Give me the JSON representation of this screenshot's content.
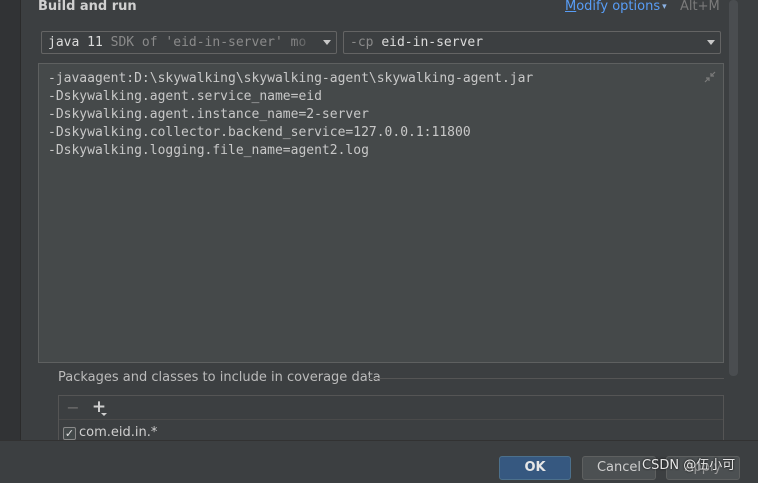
{
  "section": {
    "title": "Build and run",
    "modify_first": "M",
    "modify_rest": "odify options",
    "shortcut": "Alt+M"
  },
  "jre_combo": {
    "version": "java 11",
    "detail": "SDK of 'eid-in-server' mo"
  },
  "classpath_combo": {
    "flag": "-cp",
    "module": "eid-in-server"
  },
  "vm_options": {
    "lines": [
      "-javaagent:D:\\skywalking\\skywalking-agent\\skywalking-agent.jar",
      "-Dskywalking.agent.service_name=eid",
      "-Dskywalking.agent.instance_name=2-server",
      "-Dskywalking.collector.backend_service=127.0.0.1:11800",
      "-Dskywalking.logging.file_name=agent2.log"
    ]
  },
  "coverage": {
    "title": "Packages and classes to include in coverage data",
    "minus_glyph": "−",
    "plus_glyph": "+",
    "check_glyph": "✓",
    "items": [
      {
        "label": "com.eid.in.*",
        "checked": true
      }
    ]
  },
  "buttons": {
    "ok": "OK",
    "cancel": "Cancel",
    "apply": "Apply"
  },
  "watermark": "CSDN @伍小可",
  "colors": {
    "background": "#3c3f41",
    "editor_background": "#45494a",
    "link": "#589df6",
    "ok_button": "#365880"
  }
}
